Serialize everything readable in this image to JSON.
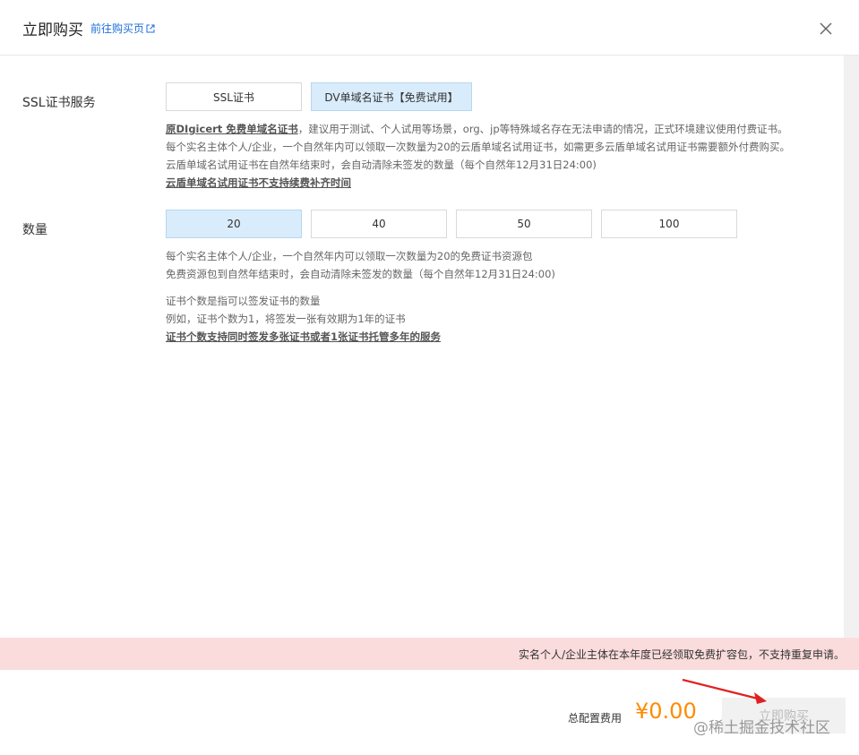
{
  "header": {
    "title": "立即购买",
    "link_label": "前往购买页"
  },
  "ssl_service": {
    "label": "SSL证书服务",
    "options": [
      {
        "label": "SSL证书",
        "selected": false
      },
      {
        "label": "DV单域名证书【免费试用】",
        "selected": true
      }
    ],
    "desc_line1_bold": "原DIgicert 免费单域名证书",
    "desc_line1_rest": "，建议用于测试、个人试用等场景，org、jp等特殊域名存在无法申请的情况，正式环境建议使用付费证书。",
    "desc_line2": "每个实名主体个人/企业，一个自然年内可以领取一次数量为20的云盾单域名试用证书，如需更多云盾单域名试用证书需要额外付费购买。",
    "desc_line3": "云盾单域名试用证书在自然年结束时，会自动清除未签发的数量（每个自然年12月31日24:00)",
    "desc_line4_bold": "云盾单域名试用证书不支持续费补齐时间"
  },
  "quantity": {
    "label": "数量",
    "options": [
      {
        "label": "20",
        "selected": true
      },
      {
        "label": "40",
        "selected": false
      },
      {
        "label": "50",
        "selected": false
      },
      {
        "label": "100",
        "selected": false
      }
    ],
    "desc_line1": "每个实名主体个人/企业，一个自然年内可以领取一次数量为20的免费证书资源包",
    "desc_line2": "免费资源包到自然年结束时，会自动清除未签发的数量（每个自然年12月31日24:00)",
    "desc_line3": "证书个数是指可以签发证书的数量",
    "desc_line4": "例如，证书个数为1，将签发一张有效期为1年的证书",
    "desc_line5_bold": "证书个数支持同时签发多张证书或者1张证书托管多年的服务"
  },
  "notice": {
    "text": "实名个人/企业主体在本年度已经领取免费扩容包，不支持重复申请。"
  },
  "footer": {
    "fee_label": "总配置费用",
    "fee_value": "¥0.00",
    "buy_label": "立即购买"
  },
  "watermark": "@稀土掘金技术社区",
  "colors": {
    "accent": "#1e6fd9",
    "selected_bg": "#d9ecfb",
    "price": "#ff8a00",
    "notice_bg": "#fbdcdc",
    "arrow": "#e02020"
  }
}
